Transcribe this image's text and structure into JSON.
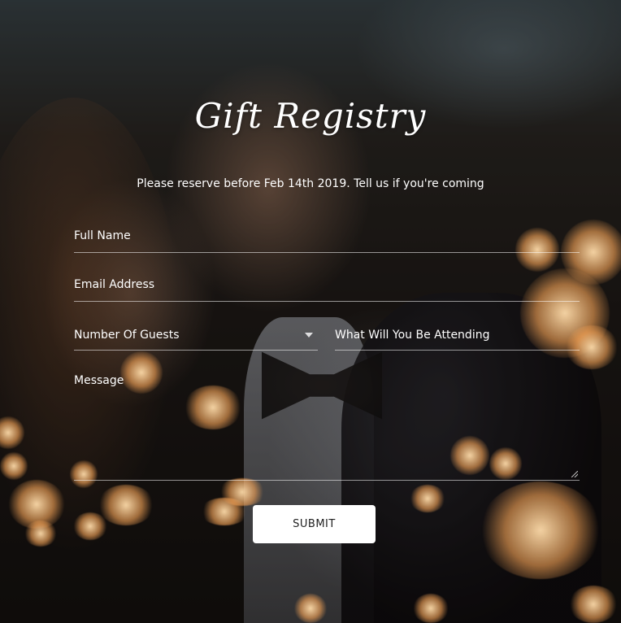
{
  "form": {
    "title": "Gift Registry",
    "subtitle": "Please reserve before Feb 14th 2019. Tell us if you're coming",
    "fields": {
      "full_name": "Full Name",
      "email": "Email Address",
      "guests": "Number Of Guests",
      "attending": "What Will You Be Attending",
      "message": "Message"
    },
    "submit_label": "SUBMIT"
  },
  "colors": {
    "text": "#ffffff",
    "button_bg": "#ffffff",
    "button_text": "#222222"
  },
  "icons": {
    "guests_dropdown": "chevron-down-icon",
    "message_resize": "resize-handle-icon"
  }
}
